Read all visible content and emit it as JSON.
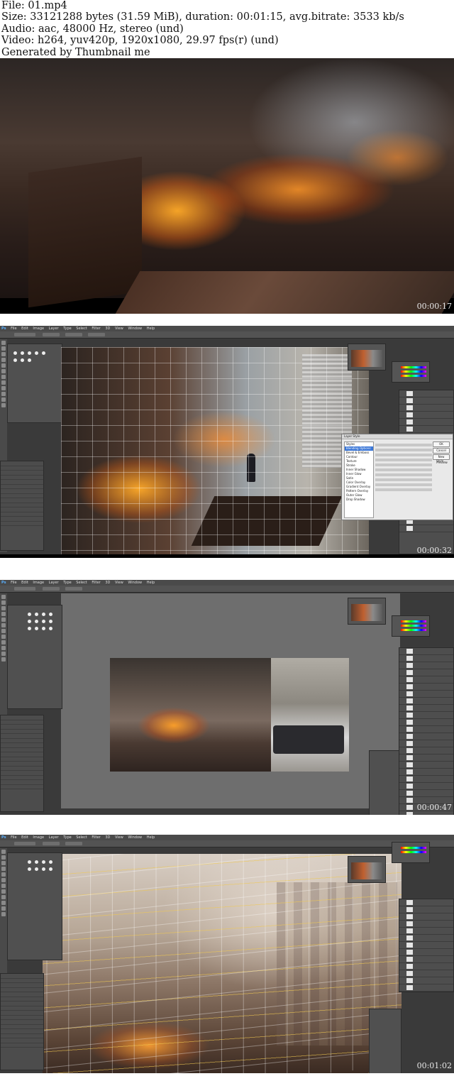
{
  "header": {
    "line1": "File: 01.mp4",
    "line2": "Size: 33121288 bytes (31.59 MiB), duration: 00:01:15, avg.bitrate: 3533 kb/s",
    "line3": "Audio: aac, 48000 Hz, stereo (und)",
    "line4": "Video: h264, yuv420p, 1920x1080, 29.97 fps(r) (und)",
    "line5": "Generated by Thumbnail me"
  },
  "frames": [
    {
      "timestamp": "00:00:17"
    },
    {
      "timestamp": "00:00:32"
    },
    {
      "timestamp": "00:00:47"
    },
    {
      "timestamp": "00:01:02"
    }
  ],
  "ps": {
    "logo": "Ps",
    "menu": [
      "File",
      "Edit",
      "Image",
      "Layer",
      "Type",
      "Select",
      "Filter",
      "3D",
      "View",
      "Window",
      "Help"
    ]
  },
  "dialog": {
    "title": "Layer Style",
    "styles": [
      "Styles",
      "Blending Options: Custom",
      "Bevel & Emboss",
      "Contour",
      "Texture",
      "Stroke",
      "Inner Shadow",
      "Inner Glow",
      "Satin",
      "Color Overlay",
      "Gradient Overlay",
      "Pattern Overlay",
      "Outer Glow",
      "Drop Shadow"
    ],
    "ok": "OK",
    "cancel": "Cancel",
    "new_style": "New Style...",
    "preview": "Preview"
  },
  "colors": {
    "ps_bg": "#3a3a3a",
    "ps_panel": "#4e4e4e",
    "timestamp": "#e8e8e8"
  }
}
